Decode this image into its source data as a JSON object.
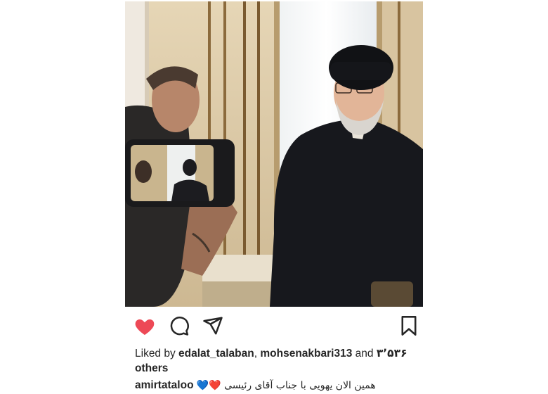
{
  "post": {
    "photo_alt_icon": "post-photo",
    "actions": {
      "like_icon": "heart-filled-icon",
      "comment_icon": "comment-icon",
      "share_icon": "send-icon",
      "save_icon": "bookmark-icon",
      "like_color": "#ed4956"
    },
    "likes": {
      "prefix": "Liked by ",
      "user1": "edalat_talaban",
      "separator": ", ",
      "user2": "mohsenakbari313",
      "and": " and ",
      "count": "۳٬۵۳۶",
      "suffix": "others"
    },
    "caption": {
      "username": "amirtataloo",
      "emoji": "💙❤️",
      "text": "همین الان یهویی با جناب آقای رئیسی"
    }
  }
}
